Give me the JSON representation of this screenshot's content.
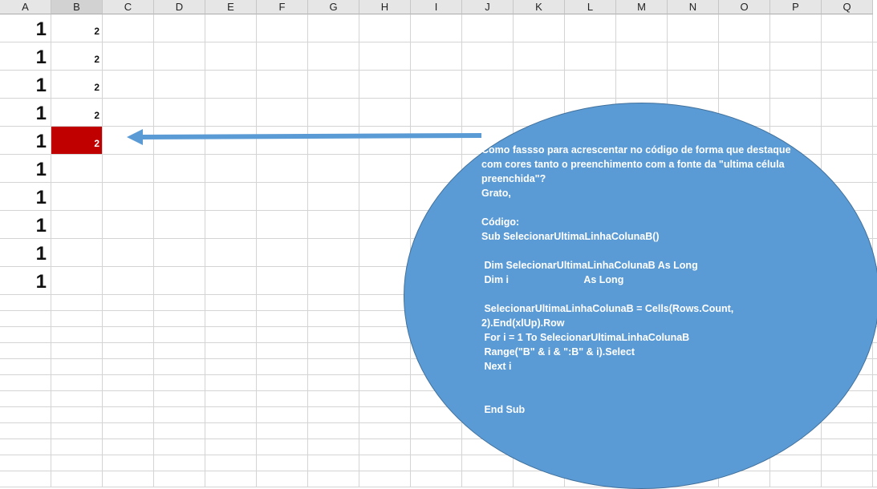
{
  "columns": [
    "A",
    "B",
    "C",
    "D",
    "E",
    "F",
    "G",
    "H",
    "I",
    "J",
    "K",
    "L",
    "M",
    "N",
    "O",
    "P",
    "Q"
  ],
  "rows": [
    {
      "a": "1",
      "b": "2"
    },
    {
      "a": "1",
      "b": "2"
    },
    {
      "a": "1",
      "b": "2"
    },
    {
      "a": "1",
      "b": "2"
    },
    {
      "a": "1",
      "b": "2"
    },
    {
      "a": "1",
      "b": ""
    },
    {
      "a": "1",
      "b": ""
    },
    {
      "a": "1",
      "b": ""
    },
    {
      "a": "1",
      "b": ""
    },
    {
      "a": "1",
      "b": ""
    }
  ],
  "highlight": {
    "row_index": 4,
    "column": "B",
    "fill_color": "#c00000",
    "font_color": "#ffffff"
  },
  "callout": {
    "shape": "ellipse",
    "fill_color": "#5b9bd5",
    "arrow_color": "#5b9bd5",
    "text": "Como fassso para acrescentar no código de forma que destaque\ncom cores tanto o preenchimento com a fonte da \"ultima célula\npreenchida\"?\nGrato,\n\nCódigo:\nSub SelecionarUltimaLinhaColunaB()\n\n Dim SelecionarUltimaLinhaColunaB As Long\n Dim i                           As Long\n\n SelecionarUltimaLinhaColunaB = Cells(Rows.Count,\n2).End(xlUp).Row\n For i = 1 To SelecionarUltimaLinhaColunaB\n Range(\"B\" & i & \":B\" & i).Select\n Next i\n\n\n End Sub"
  }
}
